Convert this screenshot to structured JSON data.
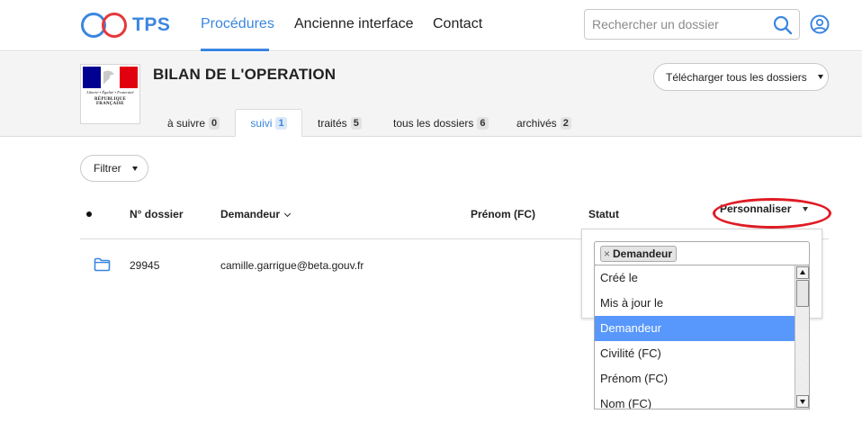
{
  "nav": {
    "brand": "TPS",
    "links": [
      "Procédures",
      "Ancienne interface",
      "Contact"
    ],
    "search_placeholder": "Rechercher un dossier"
  },
  "procedure": {
    "logo_motto": "Liberté • Égalité • Fraternité",
    "logo_republic": "RÉPUBLIQUE FRANÇAISE",
    "title": "BILAN DE L'OPERATION",
    "download_label": "Télécharger tous les dossiers",
    "tabs": [
      {
        "label": "à suivre",
        "count": "0"
      },
      {
        "label": "suivi",
        "count": "1"
      },
      {
        "label": "traités",
        "count": "5"
      },
      {
        "label": "tous les dossiers",
        "count": "6"
      },
      {
        "label": "archivés",
        "count": "2"
      }
    ],
    "active_tab": "suivi"
  },
  "filter_label": "Filtrer",
  "table": {
    "columns": [
      "N° dossier",
      "Demandeur",
      "Prénom (FC)",
      "Statut"
    ],
    "rows": [
      {
        "number": "29945",
        "applicant": "camille.garrigue@beta.gouv.fr"
      }
    ]
  },
  "personaliser": {
    "label": "Personnaliser",
    "selected_tags": [
      "Demandeur"
    ],
    "options": [
      "Créé le",
      "Mis à jour le",
      "Demandeur",
      "Civilité (FC)",
      "Prénom (FC)",
      "Nom (FC)"
    ],
    "highlighted": "Demandeur"
  },
  "colors": {
    "accent": "#3a86e0",
    "highlight": "#5897fb",
    "annotation": "#e01b24",
    "flag_blue": "#000091",
    "flag_red": "#e1000f"
  }
}
